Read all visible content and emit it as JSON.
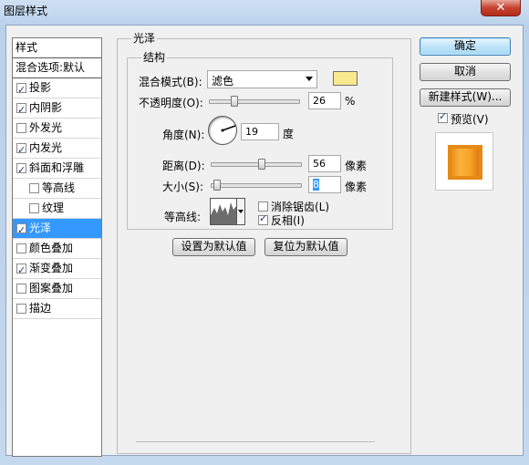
{
  "window": {
    "title": "图层样式",
    "close_glyph": "✕"
  },
  "style_list": {
    "items": [
      {
        "label": "样式",
        "kind": "head",
        "checkbox": false
      },
      {
        "label": "混合选项:默认",
        "kind": "head",
        "checkbox": false
      },
      {
        "label": "投影",
        "kind": "item",
        "checkbox": true,
        "checked": true
      },
      {
        "label": "内阴影",
        "kind": "item",
        "checkbox": true,
        "checked": true
      },
      {
        "label": "外发光",
        "kind": "item",
        "checkbox": true,
        "checked": false
      },
      {
        "label": "内发光",
        "kind": "item",
        "checkbox": true,
        "checked": true
      },
      {
        "label": "斜面和浮雕",
        "kind": "item",
        "checkbox": true,
        "checked": true
      },
      {
        "label": "等高线",
        "kind": "sub",
        "checkbox": true,
        "checked": false
      },
      {
        "label": "纹理",
        "kind": "sub",
        "checkbox": true,
        "checked": false
      },
      {
        "label": "光泽",
        "kind": "item",
        "checkbox": true,
        "checked": true,
        "selected": true
      },
      {
        "label": "颜色叠加",
        "kind": "item",
        "checkbox": true,
        "checked": false
      },
      {
        "label": "渐变叠加",
        "kind": "item",
        "checkbox": true,
        "checked": true
      },
      {
        "label": "图案叠加",
        "kind": "item",
        "checkbox": true,
        "checked": false
      },
      {
        "label": "描边",
        "kind": "item",
        "checkbox": true,
        "checked": false
      }
    ]
  },
  "satin": {
    "group_title": "光泽",
    "structure_title": "结构",
    "blend_mode_label": "混合模式(B):",
    "blend_mode_value": "滤色",
    "blend_color": "#f9e98f",
    "opacity_label": "不透明度(O):",
    "opacity_value": "26",
    "opacity_unit": "%",
    "angle_label": "角度(N):",
    "angle_value": "19",
    "angle_unit": "度",
    "distance_label": "距离(D):",
    "distance_value": "56",
    "distance_unit": "像素",
    "size_label": "大小(S):",
    "size_value": "8",
    "size_unit": "像素",
    "contour_label": "等高线:",
    "antialias_label": "消除锯齿(L)",
    "antialias_checked": false,
    "invert_label": "反相(I)",
    "invert_checked": true,
    "make_default_label": "设置为默认值",
    "reset_default_label": "复位为默认值"
  },
  "sliders": {
    "opacity_fraction": 0.26,
    "distance_fraction": 0.56,
    "size_fraction": 0.032
  },
  "actions": {
    "ok_label": "确定",
    "cancel_label": "取消",
    "new_style_label": "新建样式(W)...",
    "preview_label": "预览(V)",
    "preview_checked": true
  },
  "colors": {
    "selection": "#3399ff",
    "preview_orange": "#f39a1f"
  }
}
